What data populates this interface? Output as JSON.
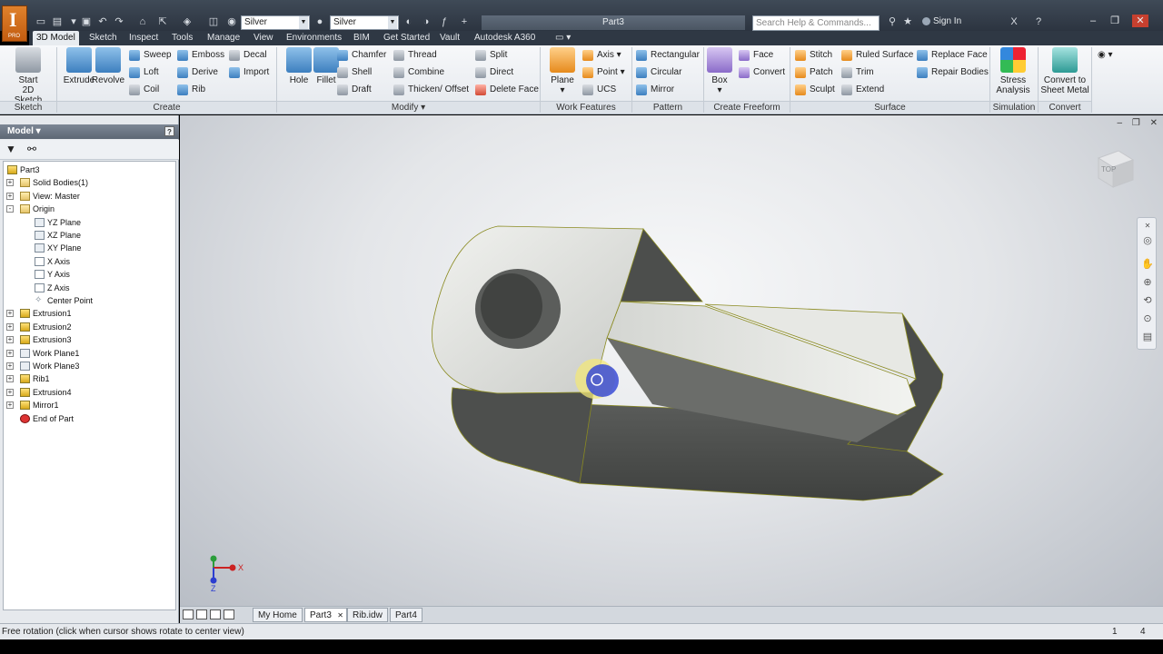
{
  "app": {
    "document_title": "Part3",
    "search_placeholder": "Search Help & Commands...",
    "signin": "Sign In",
    "material": "Silver",
    "appearance": "Silver",
    "logo_letter": "I",
    "logo_edition": "PRO"
  },
  "tabs": [
    "3D Model",
    "Sketch",
    "Inspect",
    "Tools",
    "Manage",
    "View",
    "Environments",
    "BIM",
    "Get Started",
    "Vault",
    "Autodesk A360"
  ],
  "ribbon": {
    "sketch": {
      "label": "Sketch",
      "start": "Start",
      "start2": "2D Sketch"
    },
    "create": {
      "label": "Create",
      "extrude": "Extrude",
      "revolve": "Revolve",
      "sweep": "Sweep",
      "loft": "Loft",
      "coil": "Coil",
      "emboss": "Emboss",
      "derive": "Derive",
      "rib": "Rib",
      "decal": "Decal",
      "import": "Import"
    },
    "modify": {
      "label": "Modify",
      "hole": "Hole",
      "fillet": "Fillet",
      "chamfer": "Chamfer",
      "shell": "Shell",
      "draft": "Draft",
      "thread": "Thread",
      "combine": "Combine",
      "thicken": "Thicken/ Offset",
      "split": "Split",
      "direct": "Direct",
      "delete_face": "Delete Face"
    },
    "work_features": {
      "label": "Work Features",
      "plane": "Plane",
      "axis": "Axis",
      "point": "Point",
      "ucs": "UCS"
    },
    "pattern": {
      "label": "Pattern",
      "rectangular": "Rectangular",
      "circular": "Circular",
      "mirror": "Mirror"
    },
    "freeform": {
      "label": "Create Freeform",
      "box": "Box",
      "face": "Face",
      "convert": "Convert"
    },
    "surface": {
      "label": "Surface",
      "stitch": "Stitch",
      "patch": "Patch",
      "sculpt": "Sculpt",
      "ruled": "Ruled Surface",
      "trim": "Trim",
      "extend": "Extend",
      "replace": "Replace Face",
      "repair": "Repair Bodies"
    },
    "simulation": {
      "label": "Simulation",
      "stress1": "Stress",
      "stress2": "Analysis"
    },
    "convert": {
      "label": "Convert",
      "sheet1": "Convert to",
      "sheet2": "Sheet Metal"
    }
  },
  "browser": {
    "title": "Model",
    "help": "?",
    "tree": [
      {
        "label": "Part3",
        "expander": "",
        "icon": "part"
      },
      {
        "label": "Solid Bodies(1)",
        "expander": "+",
        "icon": "folder"
      },
      {
        "label": "View: Master",
        "expander": "+",
        "icon": "folder"
      },
      {
        "label": "Origin",
        "expander": "-",
        "icon": "folder"
      },
      {
        "label": "YZ Plane",
        "expander": "",
        "icon": "plane"
      },
      {
        "label": "XZ Plane",
        "expander": "",
        "icon": "plane"
      },
      {
        "label": "XY Plane",
        "expander": "",
        "icon": "plane"
      },
      {
        "label": "X Axis",
        "expander": "",
        "icon": "axis"
      },
      {
        "label": "Y Axis",
        "expander": "",
        "icon": "axis"
      },
      {
        "label": "Z Axis",
        "expander": "",
        "icon": "axis"
      },
      {
        "label": "Center Point",
        "expander": "",
        "icon": "point"
      },
      {
        "label": "Extrusion1",
        "expander": "+",
        "icon": "feature"
      },
      {
        "label": "Extrusion2",
        "expander": "+",
        "icon": "feature"
      },
      {
        "label": "Extrusion3",
        "expander": "+",
        "icon": "feature"
      },
      {
        "label": "Work Plane1",
        "expander": "+",
        "icon": "plane"
      },
      {
        "label": "Work Plane3",
        "expander": "+",
        "icon": "plane"
      },
      {
        "label": "Rib1",
        "expander": "+",
        "icon": "feature"
      },
      {
        "label": "Extrusion4",
        "expander": "+",
        "icon": "feature"
      },
      {
        "label": "Mirror1",
        "expander": "+",
        "icon": "feature"
      },
      {
        "label": "End of Part",
        "expander": "",
        "icon": "stop"
      }
    ]
  },
  "viewport": {
    "viewcube_label": "TOP",
    "axis_x": "X",
    "axis_z": "Z"
  },
  "doc_tabs": [
    "My Home",
    "Part3",
    "Rib.idw",
    "Part4"
  ],
  "status": {
    "message": "Free rotation (click when cursor shows rotate to center view)",
    "count1": "1",
    "count2": "4"
  }
}
